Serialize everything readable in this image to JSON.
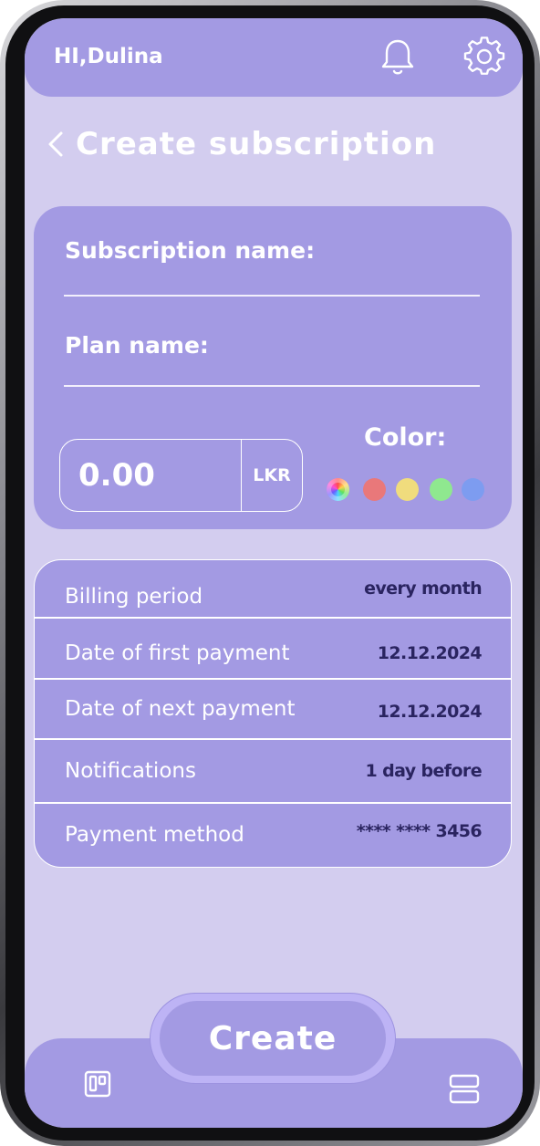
{
  "header": {
    "greeting": "HI,Dulina",
    "notifications_icon": "bell-icon",
    "settings_icon": "gear-icon"
  },
  "page": {
    "back_icon": "chevron-left-icon",
    "title": "Create subscription"
  },
  "form": {
    "subscription_name_label": "Subscription name:",
    "subscription_name_value": "",
    "plan_name_label": "Plan name:",
    "plan_name_value": "",
    "amount_value": "0.00",
    "currency": "LKR",
    "color_label": "Color:",
    "colors": [
      "rainbow",
      "#e9787a",
      "#f0dc7d",
      "#8fe88f",
      "#7d9cf0"
    ]
  },
  "details": [
    {
      "label": "Billing period",
      "value": "every month"
    },
    {
      "label": "Date of first payment",
      "value": "12.12.2024"
    },
    {
      "label": "Date of next payment",
      "value": "12.12.2024"
    },
    {
      "label": "Notifications",
      "value": "1 day before"
    },
    {
      "label": "Payment method",
      "value": "**** **** 3456"
    }
  ],
  "actions": {
    "create_label": "Create"
  },
  "bottom_nav": {
    "left_icon": "board-icon",
    "right_icon": "server-stack-icon"
  },
  "theme": {
    "background": "#d3cdef",
    "panel": "#a39ae3",
    "accent_text": "#2a2460"
  }
}
